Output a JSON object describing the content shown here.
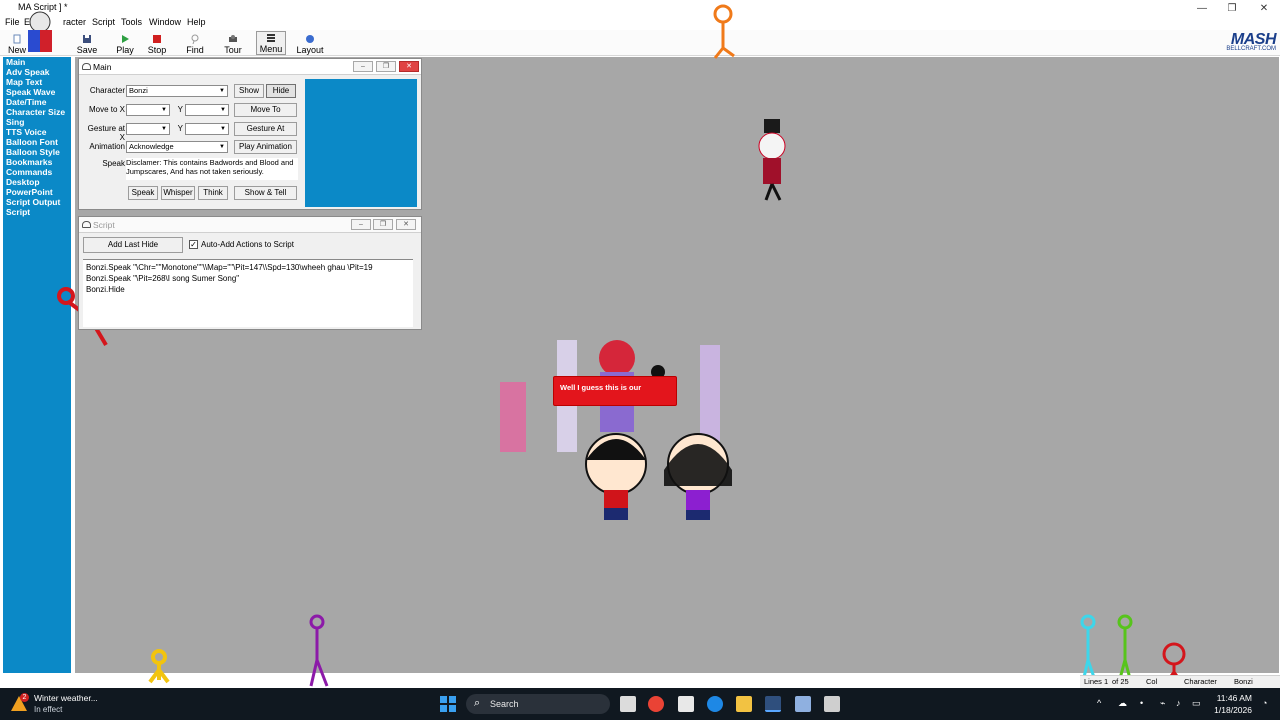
{
  "window": {
    "title": "MA  Script ] *",
    "controls": [
      "—",
      "❐",
      "✕"
    ]
  },
  "menu": [
    "File",
    "E",
    "racter",
    "Script",
    "Tools",
    "Window",
    "Help"
  ],
  "toolbar": {
    "buttons": [
      "New",
      "Save",
      "Play",
      "Stop",
      "Find",
      "Tour",
      "Menu",
      "Layout"
    ],
    "brand": "MASH",
    "brand_sub": "BELLCRAFT.COM"
  },
  "sidebar": {
    "items": [
      "Main",
      "Adv Speak",
      "Map Text",
      "Speak Wave",
      "Date/Time",
      "Character Size",
      "Sing",
      "TTS Voice",
      "Balloon Font",
      "Balloon Style",
      "Bookmarks",
      "Commands",
      "Desktop",
      "PowerPoint",
      "Script Output",
      "Script"
    ]
  },
  "main_window": {
    "title": "Main",
    "character_label": "Character",
    "character_value": "Bonzi",
    "show_label": "Show",
    "hide_label": "Hide",
    "move_to_label": "Move to X",
    "y_label": "Y",
    "move_to_button": "Move To",
    "gesture_label": "Gesture at X",
    "gesture_button": "Gesture At",
    "animation_label": "Animation",
    "animation_value": "Acknowledge",
    "play_animation_button": "Play Animation",
    "speak_label": "Speak",
    "speak_text": "Disclamer: This contains Badwords and Blood and Jumpscares, And has not taken seriously.",
    "speak_button": "Speak",
    "whisper_button": "Whisper",
    "think_button": "Think",
    "show_tell_button": "Show & Tell",
    "preview_color": "#0b89c7"
  },
  "script_window": {
    "title": "Script",
    "add_last_button": "Add Last Hide",
    "auto_add_label": "Auto-Add Actions to Script",
    "auto_add_checked": true,
    "lines": [
      "Bonzi.Speak \"\\Chr=\"\"Monotone\"\"\\\\Map=\"\"\\Pit=147\\\\Spd=130\\wheeh ghau \\Pit=19",
      "Bonzi.Speak \"\\Pit=268\\I song Sumer Song\"",
      "Bonzi.Hide"
    ]
  },
  "stage": {
    "background": "#a7a7a7",
    "balloon_text": "Well I guess this is our"
  },
  "statusbar": {
    "lines": "Lines 1",
    "of": "of 25",
    "col": "Col",
    "character_label": "Character",
    "character_value": "Bonzi"
  },
  "taskbar": {
    "weather_title": "Winter weather...",
    "weather_sub": "In effect",
    "weather_badge": "2",
    "search_placeholder": "Search",
    "time": "11:46 AM",
    "date": "1/18/2026"
  }
}
